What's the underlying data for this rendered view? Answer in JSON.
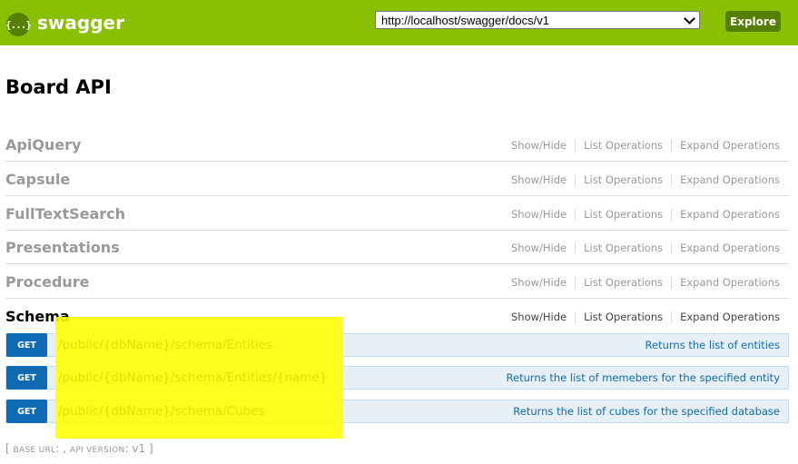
{
  "header": {
    "logo_glyph": "{...}",
    "logo_text": "swagger",
    "url_value": "http://localhost/swagger/docs/v1",
    "explore_label": "Explore",
    "colors": {
      "bar": "#89bf04",
      "button": "#547f00"
    }
  },
  "api_title": "Board API",
  "resources": [
    {
      "name": "ApiQuery"
    },
    {
      "name": "Capsule"
    },
    {
      "name": "FullTextSearch"
    },
    {
      "name": "Presentations"
    },
    {
      "name": "Procedure"
    },
    {
      "name": "Schema"
    }
  ],
  "resource_ops": {
    "show_hide": "Show/Hide",
    "list_operations": "List Operations",
    "expand_operations": "Expand Operations"
  },
  "operations": [
    {
      "method": "GET",
      "path": "/public/{dbName}/schema/Entities",
      "summary": "Returns the list of entities"
    },
    {
      "method": "GET",
      "path": "/public/{dbName}/schema/Entities/{name}",
      "summary": "Returns the list of memebers for the specified entity"
    },
    {
      "method": "GET",
      "path": "/public/{dbName}/schema/Cubes",
      "summary": "Returns the list of cubes for the specified database"
    }
  ],
  "footer": {
    "open": "[",
    "base_url_label": "BASE URL",
    "base_url_value": ": ,",
    "api_version_label": "API VERSION",
    "api_version_value": ": v1",
    "close": "]"
  }
}
